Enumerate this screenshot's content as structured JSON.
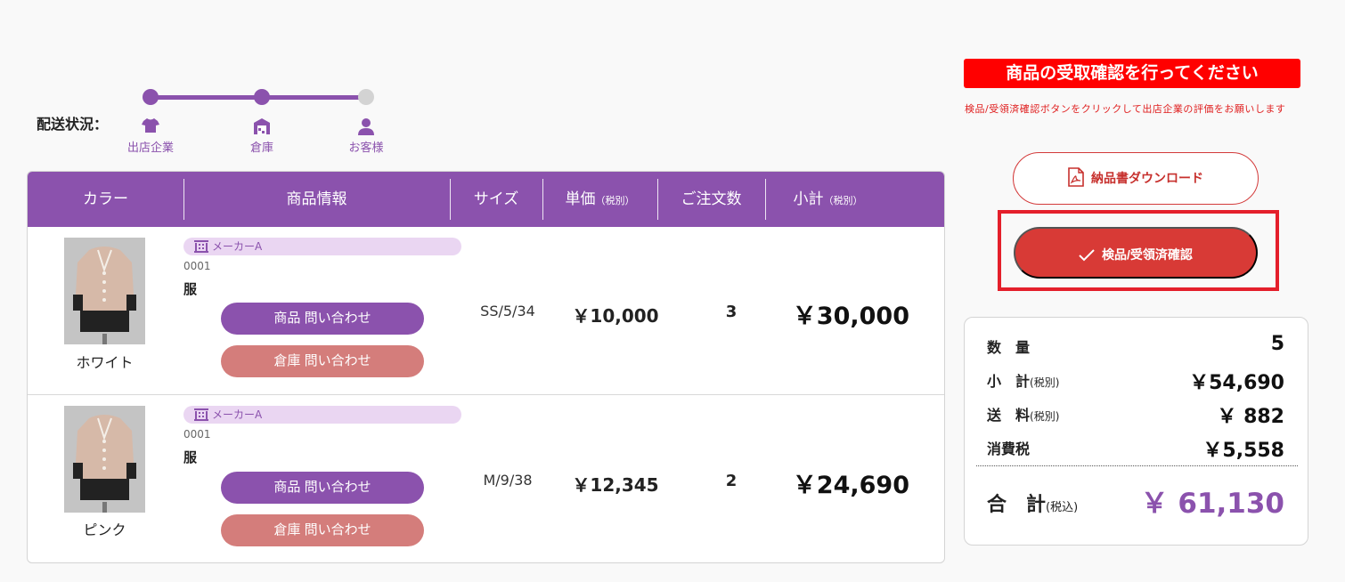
{
  "shipping": {
    "label": "配送状況：",
    "steps": [
      {
        "label": "出店企業",
        "icon": "shirt-icon",
        "active": true
      },
      {
        "label": "倉庫",
        "icon": "warehouse-icon",
        "active": true
      },
      {
        "label": "お客様",
        "icon": "person-icon",
        "active": false
      }
    ]
  },
  "table": {
    "headers": {
      "color": "カラー",
      "product": "商品情報",
      "size": "サイズ",
      "unit_price": "単価",
      "unit_price_note": "（税別）",
      "quantity": "ご注文数",
      "subtotal": "小計",
      "subtotal_note": "（税別）"
    },
    "rows": [
      {
        "color": "ホワイト",
        "maker": "メーカーA",
        "code": "0001",
        "name": "服",
        "product_inquiry": "商品 問い合わせ",
        "warehouse_inquiry": "倉庫 問い合わせ",
        "size": "SS/5/34",
        "unit_price": "￥10,000",
        "quantity": "3",
        "subtotal": "￥30,000"
      },
      {
        "color": "ピンク",
        "maker": "メーカーA",
        "code": "0001",
        "name": "服",
        "product_inquiry": "商品 問い合わせ",
        "warehouse_inquiry": "倉庫 問い合わせ",
        "size": "M/9/38",
        "unit_price": "￥12,345",
        "quantity": "2",
        "subtotal": "￥24,690"
      }
    ]
  },
  "panel": {
    "banner": "商品の受取確認を行ってください",
    "note": "検品/受領済確認ボタンをクリックして出店企業の評価をお願いします",
    "download_label": "納品書ダウンロード",
    "confirm_label": "検品/受領済確認"
  },
  "summary": {
    "quantity_label": "数　量",
    "quantity": "5",
    "subtotal_label": "小　計",
    "subtotal_note": "(税別)",
    "subtotal": "￥54,690",
    "shipping_label": "送　料",
    "shipping_note": "(税別)",
    "shipping": "￥ 882",
    "tax_label": "消費税",
    "tax": "￥5,558",
    "total_label": "合　計",
    "total_note": "(税込)",
    "total": "￥ 61,130"
  },
  "colors": {
    "brand_purple": "#8b52ad",
    "alert_red": "#ff0000",
    "confirm_red": "#d83a36",
    "inquiry_rose": "#d47d7b"
  }
}
